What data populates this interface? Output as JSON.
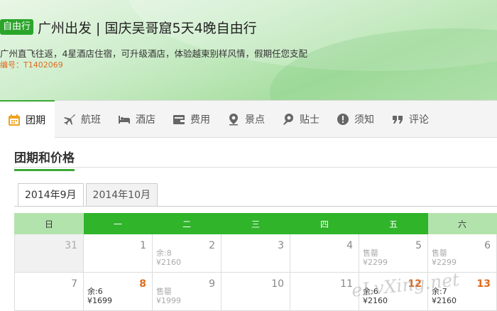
{
  "header": {
    "tag": "自由行",
    "title": "广州出发 | 国庆吴哥窟5天4晚自由行",
    "subtitle": "广州直飞往返，4星酒店住宿，可升级酒店，体验越柬别样风情，假期任您支配",
    "code": "编号：T1402069"
  },
  "nav": {
    "items": [
      {
        "label": "团期",
        "icon": "calendar-icon"
      },
      {
        "label": "航班",
        "icon": "plane-icon"
      },
      {
        "label": "酒店",
        "icon": "bed-icon"
      },
      {
        "label": "费用",
        "icon": "wallet-icon"
      },
      {
        "label": "景点",
        "icon": "map-pin-icon"
      },
      {
        "label": "贴士",
        "icon": "lightbulb-icon"
      },
      {
        "label": "须知",
        "icon": "warning-icon"
      },
      {
        "label": "评论",
        "icon": "quote-icon"
      }
    ]
  },
  "section": {
    "title": "团期和价格"
  },
  "months": [
    {
      "label": "2014年9月"
    },
    {
      "label": "2014年10月"
    }
  ],
  "calendar": {
    "weekdays": [
      "日",
      "一",
      "二",
      "三",
      "四",
      "五",
      "六"
    ],
    "weeks": [
      [
        {
          "day": "31",
          "line1": "",
          "line2": ""
        },
        {
          "day": "1",
          "line1": "",
          "line2": ""
        },
        {
          "day": "2",
          "line1": "余:8",
          "line2": "¥2160"
        },
        {
          "day": "3",
          "line1": "",
          "line2": ""
        },
        {
          "day": "4",
          "line1": "",
          "line2": ""
        },
        {
          "day": "5",
          "line1": "售罄",
          "line2": "¥2299"
        },
        {
          "day": "6",
          "line1": "售罄",
          "line2": "¥2299"
        }
      ],
      [
        {
          "day": "7",
          "line1": "",
          "line2": ""
        },
        {
          "day": "8",
          "line1": "余:6",
          "line2": "¥1699"
        },
        {
          "day": "9",
          "line1": "售罄",
          "line2": "¥1999"
        },
        {
          "day": "10",
          "line1": "",
          "line2": ""
        },
        {
          "day": "11",
          "line1": "",
          "line2": ""
        },
        {
          "day": "12",
          "line1": "余:6",
          "line2": "¥2160"
        },
        {
          "day": "13",
          "line1": "余:7",
          "line2": "¥2160"
        }
      ]
    ]
  },
  "watermark": "eLvXing.net",
  "colors": {
    "accent": "#2fb42a",
    "weekend": "#b3e3ac",
    "price_highlight": "#e06a1c"
  }
}
